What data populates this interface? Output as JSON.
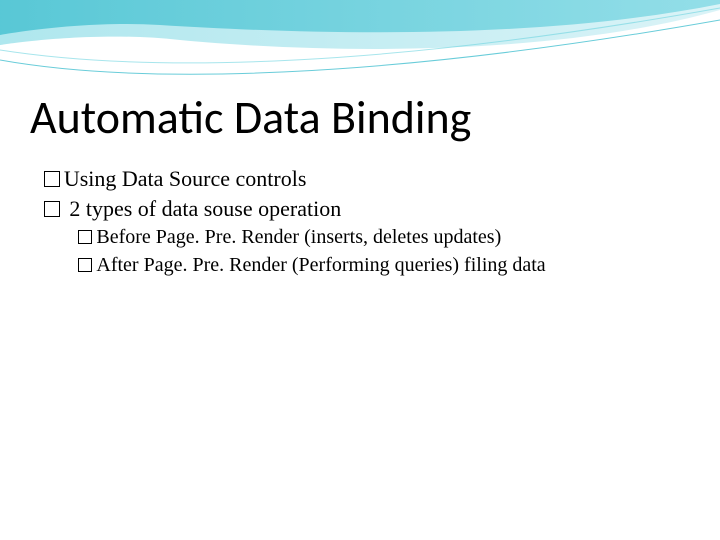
{
  "slide": {
    "title": "Automatic Data Binding",
    "bullets": [
      "Using Data Source controls",
      " 2 types of data souse operation"
    ],
    "subbullets": [
      "Before Page. Pre. Render (inserts, deletes updates)",
      "After Page. Pre. Render (Performing queries) filing data"
    ]
  }
}
